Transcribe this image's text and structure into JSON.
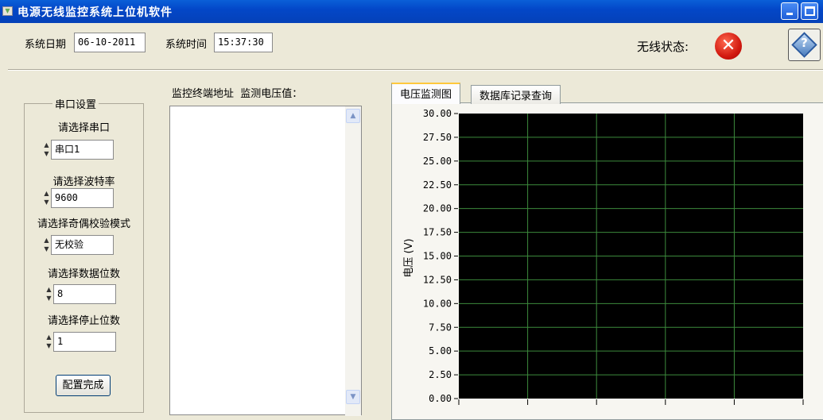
{
  "window": {
    "title": "电源无线监控系统上位机软件",
    "minimize_icon": "minimize-icon",
    "maximize_icon": "maximize-icon"
  },
  "header": {
    "date_label": "系统日期",
    "date_value": "06-10-2011",
    "time_label": "系统时间",
    "time_value": "15:37:30",
    "wireless_label": "无线状态:",
    "wireless_status": "disconnected",
    "status_icon": "error-x-icon",
    "help_icon": "help-icon"
  },
  "serial": {
    "group_title": "串口设置",
    "port_label": "请选择串口",
    "port_value": "串口1",
    "baud_label": "请选择波特率",
    "baud_value": "9600",
    "parity_label": "请选择奇偶校验模式",
    "parity_value": "无校验",
    "databits_label": "请选择数据位数",
    "databits_value": "8",
    "stopbits_label": "请选择停止位数",
    "stopbits_value": "1",
    "apply_label": "配置完成"
  },
  "monitor": {
    "header": "监控终端地址  监测电压值：",
    "items": []
  },
  "tabs": [
    {
      "label": "电压监测图",
      "active": true
    },
    {
      "label": "数据库记录查询",
      "active": false
    }
  ],
  "chart_data": {
    "type": "line",
    "ylabel": "电压 (V)",
    "ylim": [
      0,
      30
    ],
    "yticks": [
      "0.00",
      "2.50",
      "5.00",
      "7.50",
      "10.00",
      "12.50",
      "15.00",
      "17.50",
      "20.00",
      "22.50",
      "25.00",
      "27.50",
      "30.00"
    ],
    "x_divisions": 5,
    "grid": true,
    "background": "#000000",
    "grid_color": "#3c8a3c",
    "series": []
  }
}
